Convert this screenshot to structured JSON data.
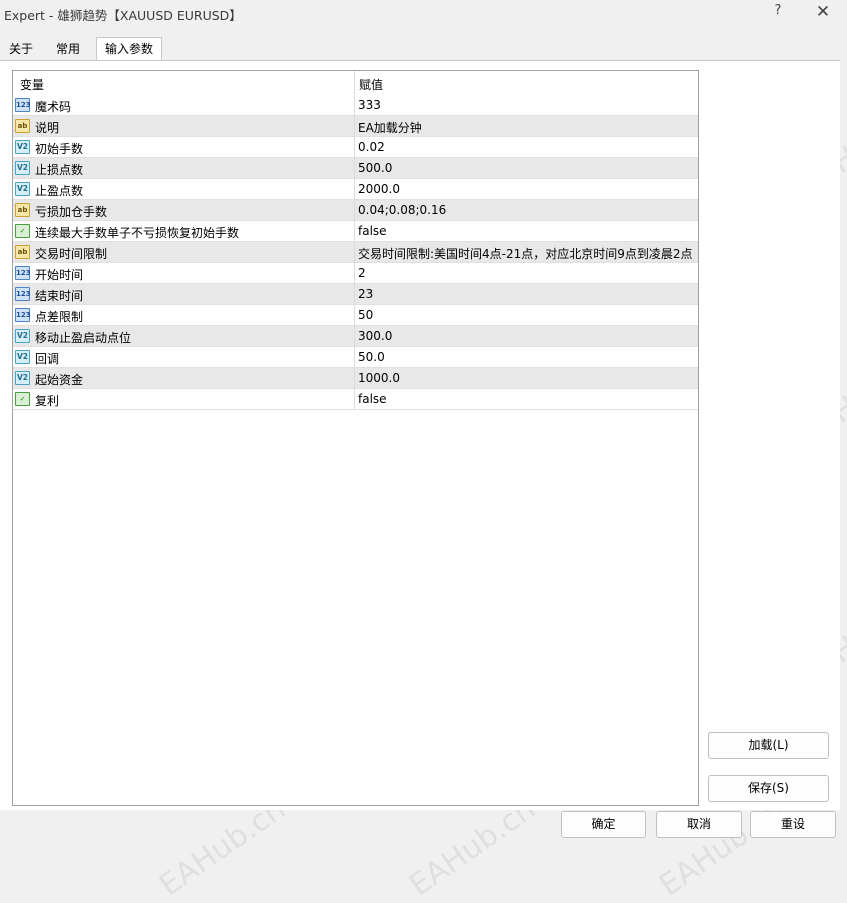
{
  "window": {
    "title": "Expert - 雄狮趋势【XAUUSD EURUSD】",
    "help": "?",
    "close": "✕"
  },
  "tabs": [
    {
      "label": "关于"
    },
    {
      "label": "常用"
    },
    {
      "label": "输入参数",
      "active": true
    }
  ],
  "grid": {
    "headers": {
      "variable": "变量",
      "value": "赋值"
    },
    "rows": [
      {
        "type": "int",
        "icon": "123",
        "name": "魔术码",
        "value": "333"
      },
      {
        "type": "str",
        "icon": "ab",
        "name": "说明",
        "value": "EA加载分钟"
      },
      {
        "type": "dbl",
        "icon": "V2",
        "name": "初始手数",
        "value": "0.02"
      },
      {
        "type": "dbl",
        "icon": "V2",
        "name": "止损点数",
        "value": "500.0"
      },
      {
        "type": "dbl",
        "icon": "V2",
        "name": "止盈点数",
        "value": "2000.0"
      },
      {
        "type": "str",
        "icon": "ab",
        "name": "亏损加仓手数",
        "value": "0.04;0.08;0.16"
      },
      {
        "type": "bool",
        "icon": "✓",
        "name": "连续最大手数单子不亏损恢复初始手数",
        "value": "false"
      },
      {
        "type": "str",
        "icon": "ab",
        "name": "交易时间限制",
        "value": "交易时间限制:美国时间4点-21点，对应北京时间9点到凌晨2点"
      },
      {
        "type": "int",
        "icon": "123",
        "name": "开始时间",
        "value": "2"
      },
      {
        "type": "int",
        "icon": "123",
        "name": "结束时间",
        "value": "23"
      },
      {
        "type": "int",
        "icon": "123",
        "name": "点差限制",
        "value": "50"
      },
      {
        "type": "dbl",
        "icon": "V2",
        "name": "移动止盈启动点位",
        "value": "300.0"
      },
      {
        "type": "dbl",
        "icon": "V2",
        "name": "回调",
        "value": "50.0"
      },
      {
        "type": "dbl",
        "icon": "V2",
        "name": "起始资金",
        "value": "1000.0"
      },
      {
        "type": "bool",
        "icon": "✓",
        "name": "复利",
        "value": "false"
      }
    ]
  },
  "buttons": {
    "load": "加载(L)",
    "save": "保存(S)",
    "ok": "确定",
    "cancel": "取消",
    "reset": "重设"
  },
  "watermark": "EAHub.cn"
}
